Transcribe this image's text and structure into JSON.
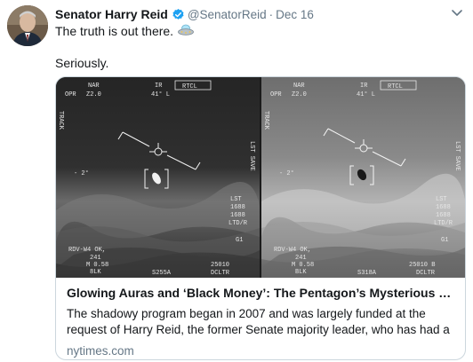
{
  "tweet": {
    "author_name": "Senator Harry Reid",
    "handle": "@SenatorReid",
    "separator": "·",
    "date": "Dec 16",
    "line1": "The truth is out there.",
    "line2": "Seriously.",
    "emoji_icon": "flying-saucer-icon"
  },
  "card": {
    "title": "Glowing Auras and ‘Black Money’: The Pentagon’s Mysterious U.F.O. ...",
    "description": "The shadowy program began in 2007 and was largely funded at the request of Harry Reid, the former Senate majority leader, who has had a longtime i...",
    "domain": "nytimes.com"
  },
  "hud_left": {
    "top_left1": "NAR",
    "top_left2": "OPR",
    "top_left3": "Z2.0",
    "top_mid1": "IR",
    "top_mid2": "41° L",
    "top_box": "RTCL",
    "left_vert": "TRACK",
    "left_deg": "- 2°",
    "right_vert": "LST SAVE",
    "right_list": [
      "LST",
      "1688",
      "1688",
      "LTD/R"
    ],
    "right_g": "G1",
    "bottom_left": [
      "RDV-W4 OK,",
      "241",
      "M 0.58",
      "8LK"
    ],
    "bottom_mid": "S255A",
    "bottom_right1": "25010",
    "bottom_right2": "DCLTR"
  },
  "hud_right": {
    "top_left1": "NAR",
    "top_left2": "OPR",
    "top_left3": "Z2.0",
    "top_mid1": "IR",
    "top_mid2": "41° L",
    "top_box": "RTCL",
    "left_vert": "TRACK",
    "left_deg": "- 2°",
    "right_vert": "LST SAVE",
    "right_list": [
      "LST",
      "1688",
      "1688",
      "LTD/R"
    ],
    "right_g": "G1",
    "bottom_left": [
      "RDV-W4 OK,",
      "241",
      "M 0.58",
      "BLK"
    ],
    "bottom_mid": "S318A",
    "bottom_right1": "25010 B",
    "bottom_right2": "DCLTR"
  },
  "colors": {
    "text": "#14171a",
    "muted": "#657786",
    "verified": "#1da1f2",
    "border": "#ccd6dd"
  }
}
